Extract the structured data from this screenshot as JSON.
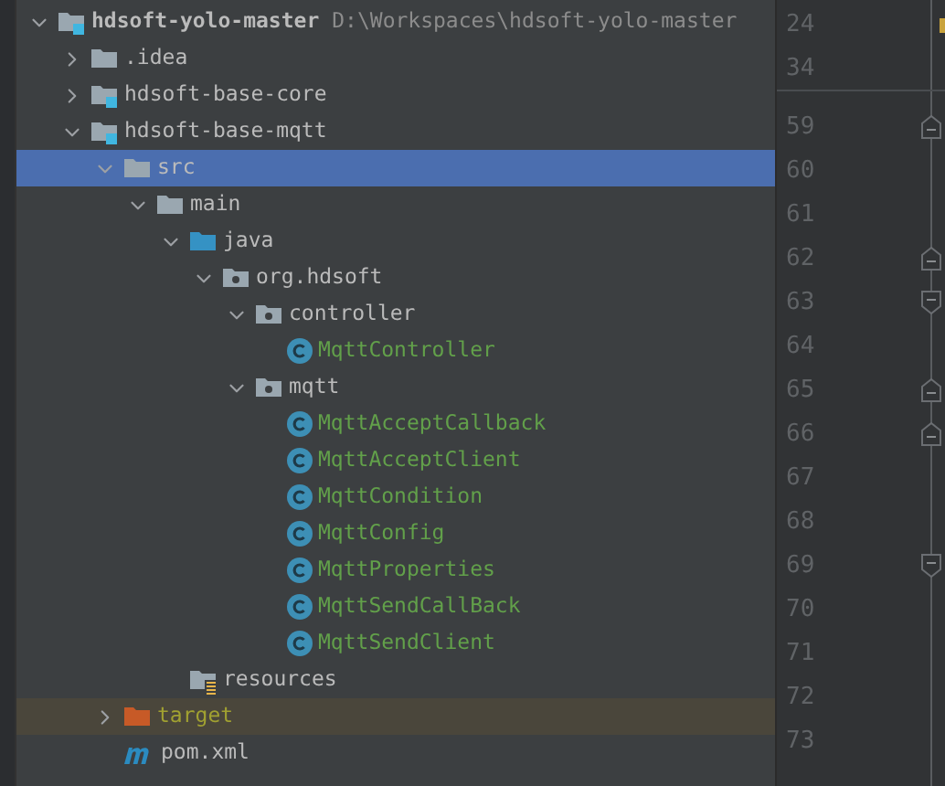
{
  "project_tree": {
    "items": [
      {
        "name": "hdsoft-yolo-master",
        "path": "D:\\Workspaces\\hdsoft-yolo-master",
        "kind": "module",
        "expanded": true,
        "selected": false,
        "added": false,
        "ignored": false,
        "children": [
          {
            "name": ".idea",
            "kind": "folder",
            "expanded": false,
            "selected": false,
            "added": false,
            "ignored": false
          },
          {
            "name": "hdsoft-base-core",
            "kind": "module",
            "expanded": false,
            "selected": false,
            "added": false,
            "ignored": false
          },
          {
            "name": "hdsoft-base-mqtt",
            "kind": "module",
            "expanded": true,
            "selected": false,
            "added": false,
            "ignored": false,
            "children": [
              {
                "name": "src",
                "kind": "folder",
                "expanded": true,
                "selected": true,
                "added": false,
                "ignored": false,
                "children": [
                  {
                    "name": "main",
                    "kind": "folder",
                    "expanded": true,
                    "selected": false,
                    "added": false,
                    "ignored": false,
                    "children": [
                      {
                        "name": "java",
                        "kind": "source",
                        "expanded": true,
                        "selected": false,
                        "added": false,
                        "ignored": false,
                        "children": [
                          {
                            "name": "org.hdsoft",
                            "kind": "package",
                            "expanded": true,
                            "selected": false,
                            "added": false,
                            "ignored": false,
                            "children": [
                              {
                                "name": "controller",
                                "kind": "package",
                                "expanded": true,
                                "selected": false,
                                "added": false,
                                "ignored": false,
                                "children": [
                                  {
                                    "name": "MqttController",
                                    "kind": "class",
                                    "selected": false,
                                    "added": true,
                                    "ignored": false
                                  }
                                ]
                              },
                              {
                                "name": "mqtt",
                                "kind": "package",
                                "expanded": true,
                                "selected": false,
                                "added": false,
                                "ignored": false,
                                "children": [
                                  {
                                    "name": "MqttAcceptCallback",
                                    "kind": "class",
                                    "selected": false,
                                    "added": true,
                                    "ignored": false
                                  },
                                  {
                                    "name": "MqttAcceptClient",
                                    "kind": "class",
                                    "selected": false,
                                    "added": true,
                                    "ignored": false
                                  },
                                  {
                                    "name": "MqttCondition",
                                    "kind": "class",
                                    "selected": false,
                                    "added": true,
                                    "ignored": false
                                  },
                                  {
                                    "name": "MqttConfig",
                                    "kind": "class",
                                    "selected": false,
                                    "added": true,
                                    "ignored": false
                                  },
                                  {
                                    "name": "MqttProperties",
                                    "kind": "class",
                                    "selected": false,
                                    "added": true,
                                    "ignored": false
                                  },
                                  {
                                    "name": "MqttSendCallBack",
                                    "kind": "class",
                                    "selected": false,
                                    "added": true,
                                    "ignored": false
                                  },
                                  {
                                    "name": "MqttSendClient",
                                    "kind": "class",
                                    "selected": false,
                                    "added": true,
                                    "ignored": false
                                  }
                                ]
                              }
                            ]
                          }
                        ]
                      },
                      {
                        "name": "resources",
                        "kind": "resources",
                        "selected": false,
                        "added": false,
                        "ignored": false
                      }
                    ]
                  }
                ]
              },
              {
                "name": "target",
                "kind": "excluded",
                "expanded": false,
                "selected": false,
                "added": false,
                "ignored": true
              },
              {
                "name": "pom.xml",
                "kind": "maven",
                "selected": false,
                "added": false,
                "ignored": false
              }
            ]
          }
        ]
      }
    ]
  },
  "gutter": {
    "sticky_lines": [
      "24",
      "34"
    ],
    "lines": [
      {
        "number": "59",
        "kind": "open"
      },
      {
        "number": "60",
        "kind": "plain"
      },
      {
        "number": "61",
        "kind": "plain"
      },
      {
        "number": "62",
        "kind": "open"
      },
      {
        "number": "63",
        "kind": "close"
      },
      {
        "number": "64",
        "kind": "plain"
      },
      {
        "number": "65",
        "kind": "open"
      },
      {
        "number": "66",
        "kind": "open"
      },
      {
        "number": "67",
        "kind": "plain"
      },
      {
        "number": "68",
        "kind": "plain"
      },
      {
        "number": "69",
        "kind": "close"
      },
      {
        "number": "70",
        "kind": "plain"
      },
      {
        "number": "71",
        "kind": "plain"
      },
      {
        "number": "72",
        "kind": "plain"
      },
      {
        "number": "73",
        "kind": "plain"
      }
    ]
  }
}
